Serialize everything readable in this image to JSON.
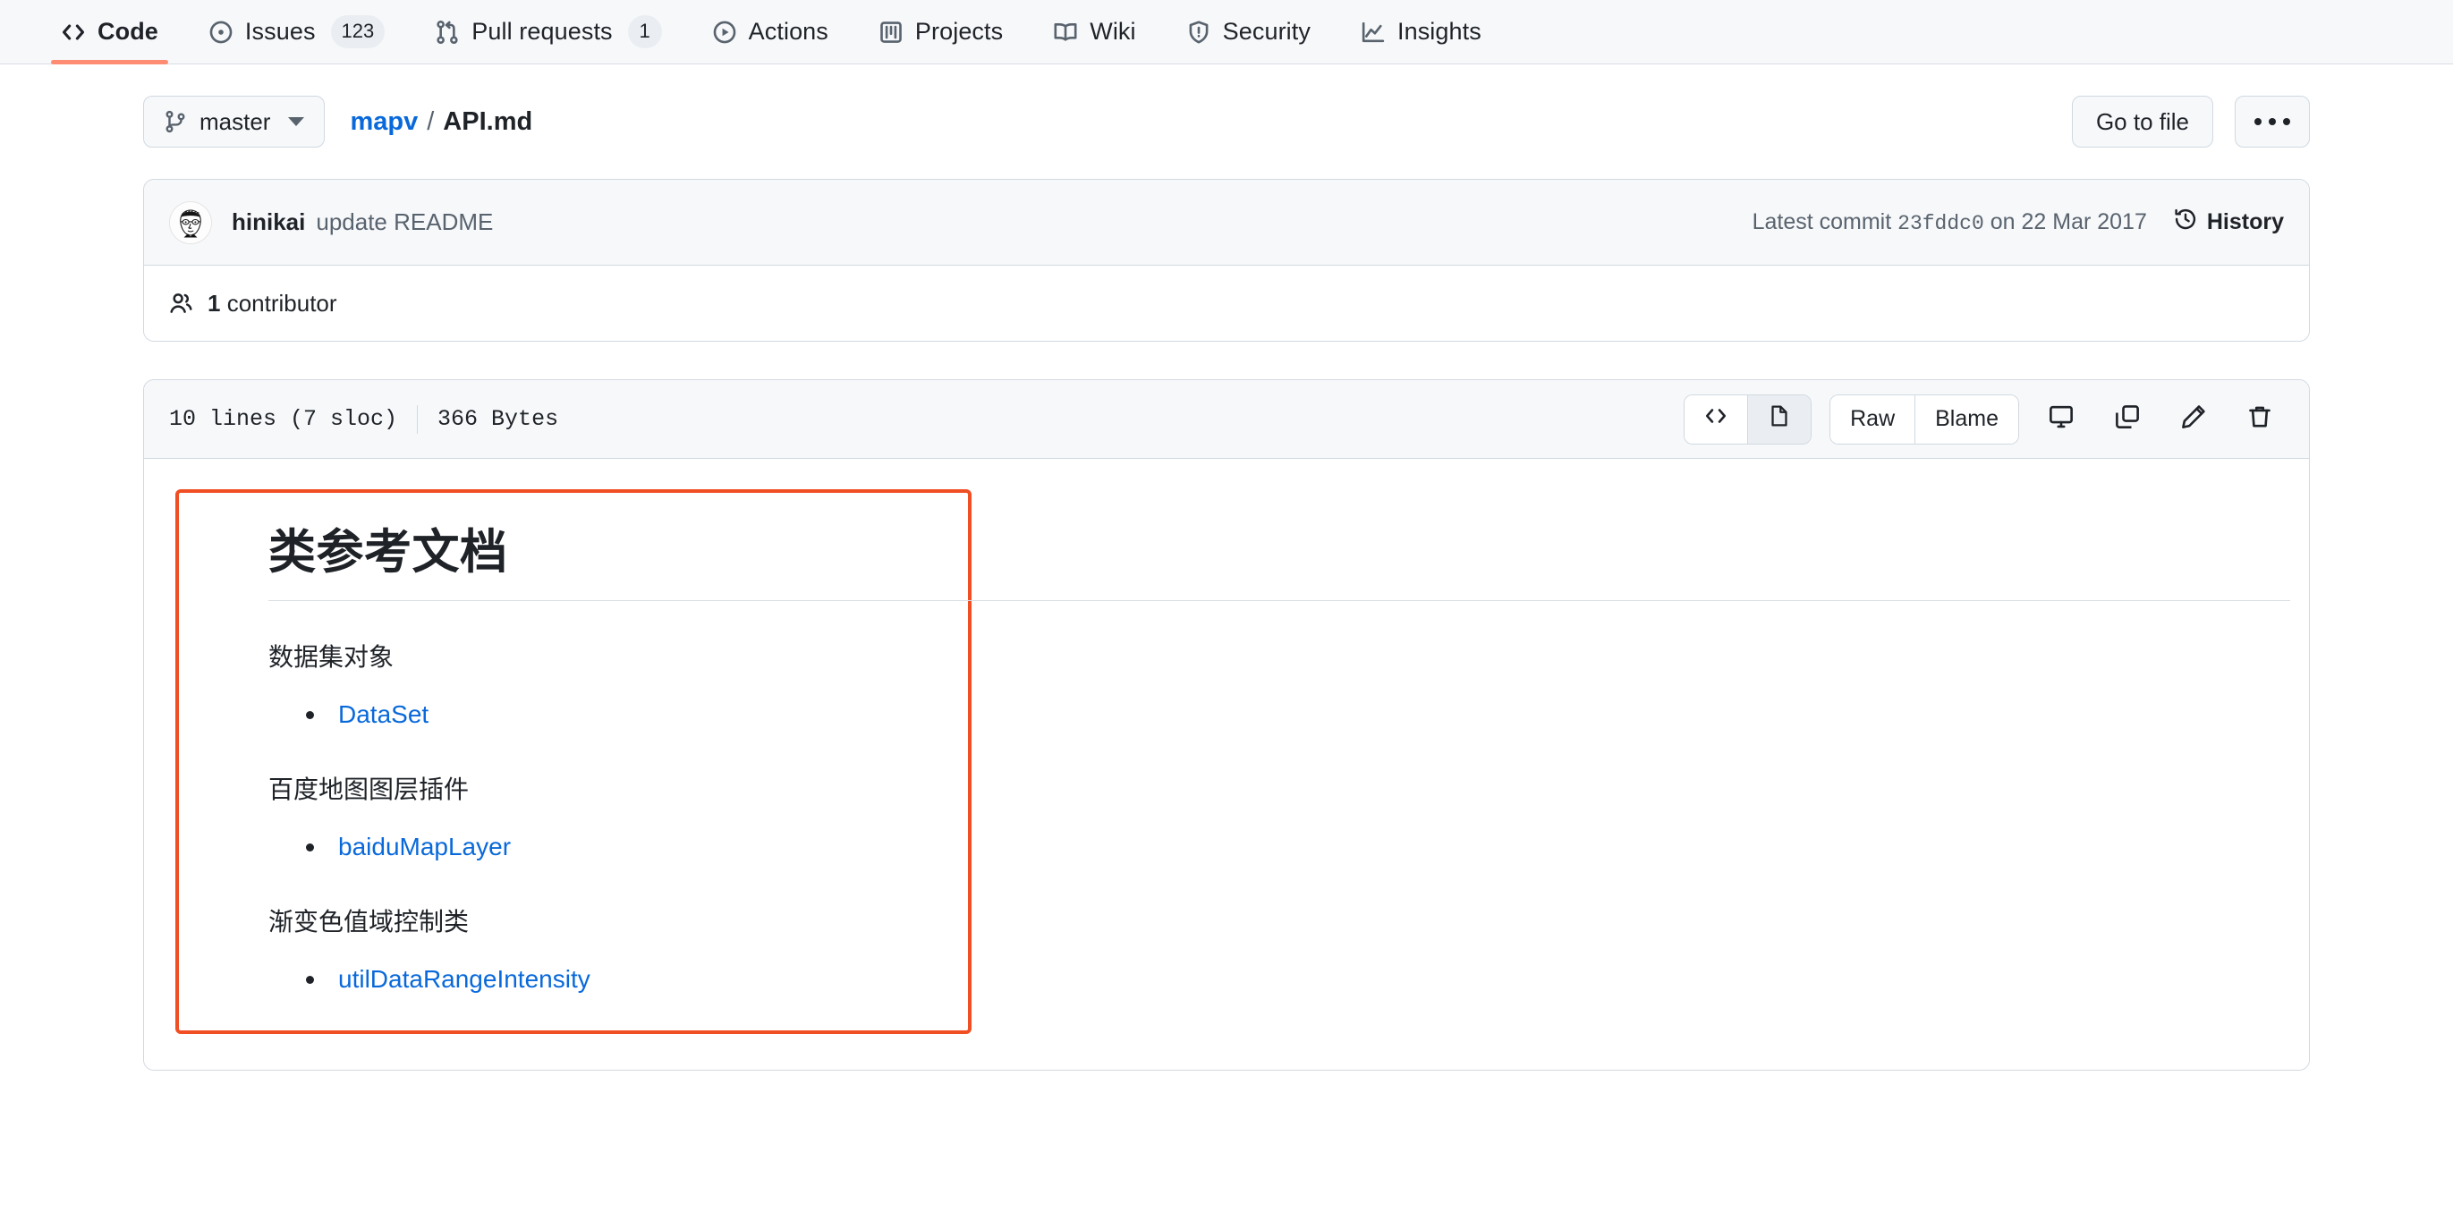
{
  "repo_nav": {
    "items": [
      {
        "label": "Code",
        "icon": "code-icon",
        "count": null,
        "active": true
      },
      {
        "label": "Issues",
        "icon": "issue-opened-icon",
        "count": "123",
        "active": false
      },
      {
        "label": "Pull requests",
        "icon": "git-pull-request-icon",
        "count": "1",
        "active": false
      },
      {
        "label": "Actions",
        "icon": "play-icon",
        "count": null,
        "active": false
      },
      {
        "label": "Projects",
        "icon": "project-icon",
        "count": null,
        "active": false
      },
      {
        "label": "Wiki",
        "icon": "book-icon",
        "count": null,
        "active": false
      },
      {
        "label": "Security",
        "icon": "shield-icon",
        "count": null,
        "active": false
      },
      {
        "label": "Insights",
        "icon": "graph-icon",
        "count": null,
        "active": false
      }
    ],
    "active_underline_color": "#fd8c73"
  },
  "file_header": {
    "branch": "master",
    "breadcrumb": {
      "repo": "mapv",
      "separator": "/",
      "file": "API.md"
    },
    "go_to_file_label": "Go to file",
    "kebab_label": "..."
  },
  "commit": {
    "author": "hinikai",
    "message": "update README",
    "latest_commit_prefix": "Latest commit",
    "sha": "23fddc0",
    "date_prefix": "on",
    "date": "22 Mar 2017",
    "history_label": "History",
    "contributors_count": "1",
    "contributors_label": "contributor"
  },
  "file_toolbar": {
    "lines": "10 lines (7 sloc)",
    "size": "366 Bytes",
    "code_view_label": "<>",
    "preview_view_label": "file",
    "raw_label": "Raw",
    "blame_label": "Blame",
    "icons": [
      "display-icon",
      "copy-icon",
      "pencil-icon",
      "trash-icon"
    ],
    "selected_view": "preview"
  },
  "markdown": {
    "highlight_color": "#f04e23",
    "heading": "类参考文档",
    "sections": [
      {
        "title": "数据集对象",
        "items": [
          "DataSet"
        ]
      },
      {
        "title": "百度地图图层插件",
        "items": [
          "baiduMapLayer"
        ]
      },
      {
        "title": "渐变色值域控制类",
        "items": [
          "utilDataRangeIntensity"
        ]
      }
    ]
  }
}
